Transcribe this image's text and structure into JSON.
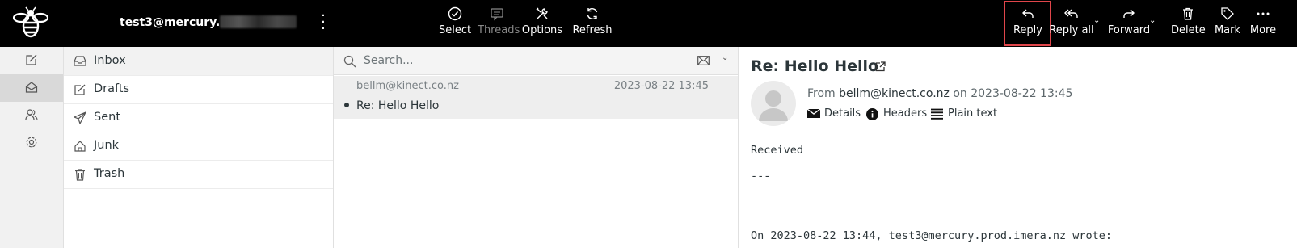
{
  "app": {
    "account": "test3@mercury."
  },
  "toolbar": {
    "select": "Select",
    "threads": "Threads",
    "options": "Options",
    "refresh": "Refresh",
    "reply": "Reply",
    "reply_all": "Reply all",
    "forward": "Forward",
    "delete": "Delete",
    "mark": "Mark",
    "more": "More"
  },
  "folders": [
    {
      "label": "Inbox",
      "icon": "inbox-icon",
      "active": true
    },
    {
      "label": "Drafts",
      "icon": "drafts-icon"
    },
    {
      "label": "Sent",
      "icon": "sent-icon"
    },
    {
      "label": "Junk",
      "icon": "junk-icon"
    },
    {
      "label": "Trash",
      "icon": "trash-icon"
    }
  ],
  "search": {
    "placeholder": "Search..."
  },
  "messages": [
    {
      "from": "bellm@kinect.co.nz",
      "date": "2023-08-22 13:45",
      "subject": "Re: Hello Hello",
      "unread": true
    }
  ],
  "reader": {
    "subject": "Re: Hello Hello",
    "from_prefix": "From",
    "from": "bellm@kinect.co.nz",
    "on": "on",
    "date": "2023-08-22 13:45",
    "details": "Details",
    "headers": "Headers",
    "plain_text": "Plain text",
    "body": [
      "Received",
      "---",
      "On 2023-08-22 13:44, test3@mercury.prod.imera.nz wrote:"
    ]
  },
  "colors": {
    "topbar": "#000000",
    "highlight": "#e0454a",
    "accent_text": "#2c363a"
  }
}
